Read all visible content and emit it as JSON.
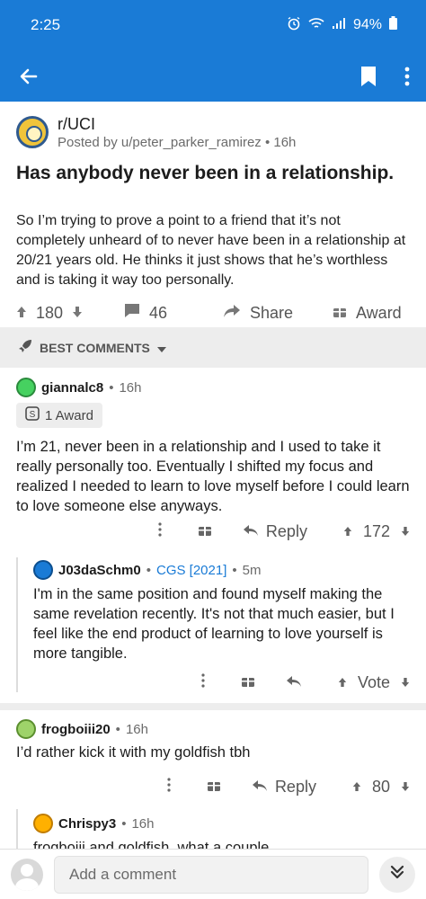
{
  "status_bar": {
    "time": "2:25",
    "battery": "94%"
  },
  "post": {
    "subreddit": "r/UCI",
    "meta": "Posted by u/peter_parker_ramirez • 16h",
    "title": "Has anybody never been in a relationship.",
    "body": "So I’m trying to prove a point to a friend that it’s not completely unheard of to never have been in a relationship at 20/21 years old. He thinks it just shows that he’s worthless and is taking it way too personally.",
    "upvotes": "180",
    "comments": "46",
    "share_label": "Share",
    "award_label": "Award"
  },
  "sort": {
    "label": "BEST COMMENTS"
  },
  "comments": [
    {
      "author": "giannalc8",
      "time": "16h",
      "award": "1 Award",
      "body": "I’m 21, never been in a relationship and I used to take it really personally too. Eventually I shifted my focus and realized I needed to learn to love myself before I could learn to love someone else anyways.",
      "reply_label": "Reply",
      "score": "172"
    },
    {
      "author": "J03daSchm0",
      "flair": "CGS [2021]",
      "time": "5m",
      "body": "I'm in the same position and found myself making the same revelation recently. It's not that much easier, but I feel like the end product of learning to love yourself is more tangible.",
      "score": "Vote"
    },
    {
      "author": "frogboiii20",
      "time": "16h",
      "body": "I’d rather kick it with my goldfish tbh",
      "reply_label": "Reply",
      "score": "80"
    },
    {
      "author": "Chrispy3",
      "time": "16h",
      "body": "frogboiii and goldfish, what a couple"
    }
  ],
  "bottom": {
    "placeholder": "Add a comment"
  }
}
